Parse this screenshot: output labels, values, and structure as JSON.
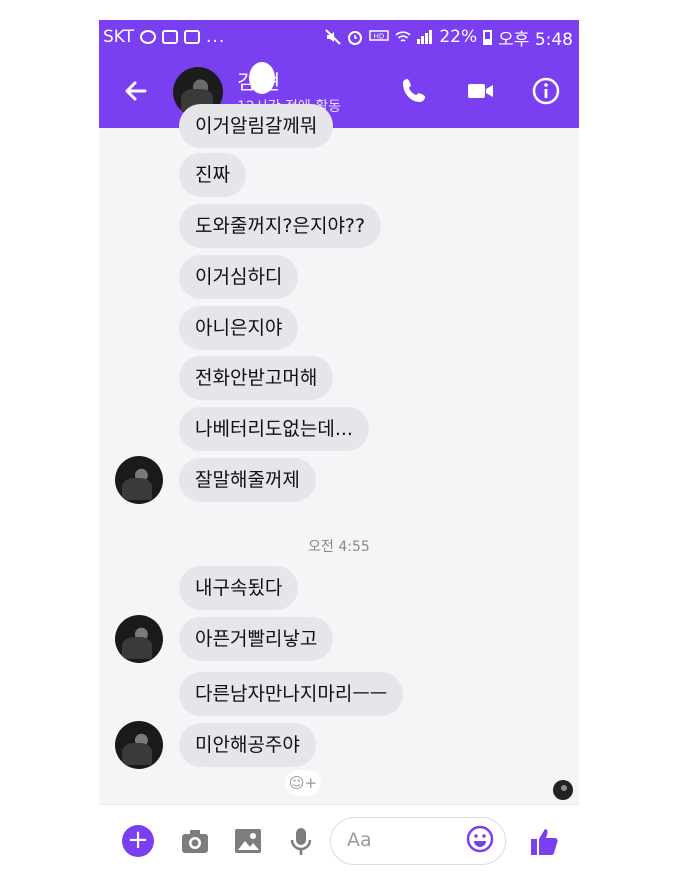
{
  "status_bar": {
    "carrier": "SKT",
    "right_text": "22%",
    "time": "오후 5:48",
    "dots": "..."
  },
  "header": {
    "contact_name": "김 현",
    "active_status": "12시간 전에 활동",
    "accent_color": "#7a3ff0"
  },
  "messages": [
    {
      "text": "이거알림갈께뭐"
    },
    {
      "text": "진짜"
    },
    {
      "text": "도와줄꺼지?은지야??"
    },
    {
      "text": "이거심하디"
    },
    {
      "text": "아니은지야"
    },
    {
      "text": "전화안받고머해"
    },
    {
      "text": "나베터리도없는데..."
    },
    {
      "text": "잘말해줄꺼제"
    },
    {
      "text": "내구속됬다"
    },
    {
      "text": "아픈거빨리낳고"
    },
    {
      "text": "다른남자만나지마리ㅡㅡ"
    },
    {
      "text": "미안해공주야"
    }
  ],
  "timestamp": "오전 4:55",
  "reaction_hint": "☺+",
  "composer": {
    "placeholder": "Aa"
  },
  "icons": [
    "back-arrow-icon",
    "phone-icon",
    "video-icon",
    "info-icon",
    "plus-icon",
    "camera-icon",
    "image-icon",
    "microphone-icon",
    "emoji-icon",
    "thumbs-up-icon"
  ]
}
